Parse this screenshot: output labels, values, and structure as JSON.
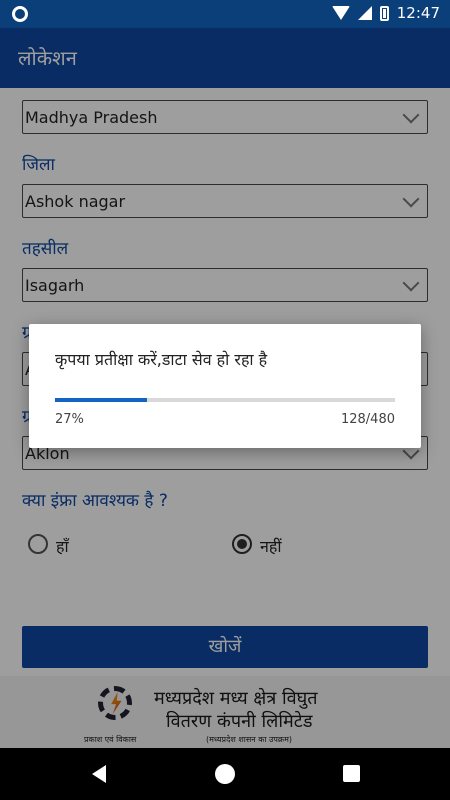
{
  "status_bar": {
    "time": "12:47"
  },
  "app_bar": {
    "title": "लोकेशन"
  },
  "form": {
    "state_value": "Madhya Pradesh",
    "district_label": "जिला",
    "district_value": "Ashok nagar",
    "tehsil_label": "तहसील",
    "tehsil_value": "Isagarh",
    "gram_label": "ग्र",
    "gram_value": "A",
    "village_label": "ग्र",
    "village_value": "Aklon",
    "infra_question": "क्या इंफ्रा आवश्यक है ?",
    "radio_yes": "हाँ",
    "radio_no": "नहीं",
    "radio_selected": "no",
    "search_button": "खोजें"
  },
  "footer": {
    "org_line1": "मध्यप्रदेश मध्य क्षेत्र विघुत",
    "org_line2": "वितरण कंपनी लिमिटेड",
    "tagline": "प्रकाश एवं विकास",
    "subtitle": "(मध्यप्रदेश शासन का उपक्रम)"
  },
  "dialog": {
    "message": "कृपया प्रतीक्षा करें,डाटा सेव हो रहा है",
    "progress_percent": "27%",
    "progress_fraction": 0.27,
    "progress_count": "128/480",
    "accent_color": "#1565c0"
  },
  "nav": {
    "icons": [
      "back-icon",
      "home-icon",
      "recents-icon"
    ]
  }
}
